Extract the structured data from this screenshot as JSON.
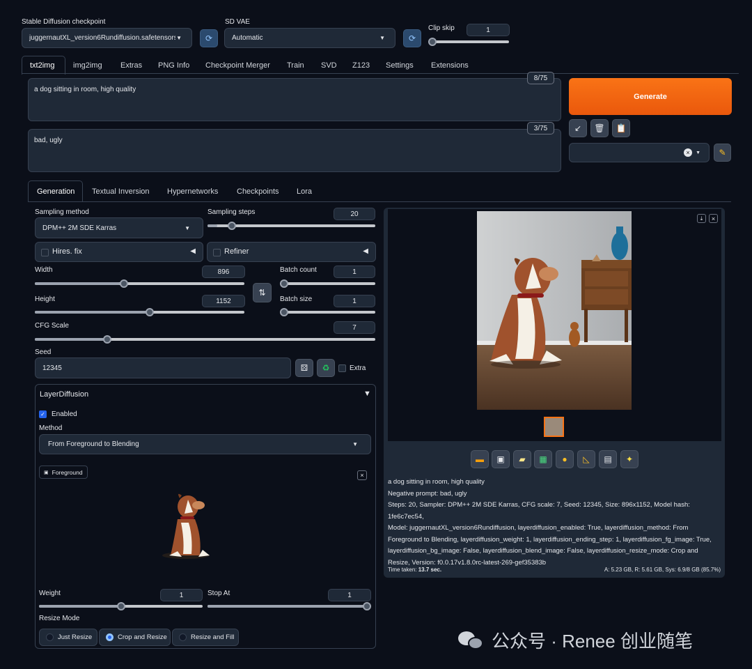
{
  "top": {
    "checkpoint_label": "Stable Diffusion checkpoint",
    "checkpoint_value": "juggernautXL_version6Rundiffusion.safetensors",
    "vae_label": "SD VAE",
    "vae_value": "Automatic",
    "clip_label": "Clip skip",
    "clip_value": "1"
  },
  "tabs": [
    "txt2img",
    "img2img",
    "Extras",
    "PNG Info",
    "Checkpoint Merger",
    "Train",
    "SVD",
    "Z123",
    "Settings",
    "Extensions"
  ],
  "prompt": {
    "text": "a dog sitting in room, high quality",
    "counter": "8/75"
  },
  "negative": {
    "text": "bad, ugly",
    "counter": "3/75"
  },
  "generate_label": "Generate",
  "subtabs": [
    "Generation",
    "Textual Inversion",
    "Hypernetworks",
    "Checkpoints",
    "Lora"
  ],
  "gen": {
    "sampling_method_label": "Sampling method",
    "sampling_method": "DPM++ 2M SDE Karras",
    "sampling_steps_label": "Sampling steps",
    "sampling_steps": "20",
    "hires": "Hires. fix",
    "refiner": "Refiner",
    "width_label": "Width",
    "width": "896",
    "height_label": "Height",
    "height": "1152",
    "batch_count_label": "Batch count",
    "batch_count": "1",
    "batch_size_label": "Batch size",
    "batch_size": "1",
    "cfg_label": "CFG Scale",
    "cfg": "7",
    "seed_label": "Seed",
    "seed": "12345",
    "extra": "Extra"
  },
  "layer": {
    "title": "LayerDiffusion",
    "enabled": "Enabled",
    "method_label": "Method",
    "method": "From Foreground to Blending",
    "foreground_label": "Foreground",
    "weight_label": "Weight",
    "weight": "1",
    "stop_label": "Stop At",
    "stop": "1",
    "resize_label": "Resize Mode",
    "resize_options": [
      "Just Resize",
      "Crop and Resize",
      "Resize and Fill"
    ]
  },
  "output": {
    "line1": "a dog sitting in room, high quality",
    "line2": "Negative prompt: bad, ugly",
    "line3": "Steps: 20, Sampler: DPM++ 2M SDE Karras, CFG scale: 7, Seed: 12345, Size: 896x1152, Model hash: 1fe6c7ec54,",
    "line4": "Model: juggernautXL_version6Rundiffusion, layerdiffusion_enabled: True, layerdiffusion_method: From",
    "line5": "Foreground to Blending, layerdiffusion_weight: 1, layerdiffusion_ending_step: 1, layerdiffusion_fg_image: True,",
    "line6": "layerdiffusion_bg_image: False, layerdiffusion_blend_image: False, layerdiffusion_resize_mode: Crop and",
    "line7": "Resize, Version: f0.0.17v1.8.0rc-latest-269-gef35383b",
    "time_label": "Time taken:",
    "time_value": "13.7 sec.",
    "mem": "A: 5.23 GB, R: 5.61 GB, Sys: 6.9/8 GB (85.7%)"
  },
  "watermark": "公众号 · Renee 创业随笔",
  "colors": {
    "accent": "#f97316",
    "bg": "#0b0f19",
    "panel": "#1f2937",
    "check": "#2563eb"
  }
}
